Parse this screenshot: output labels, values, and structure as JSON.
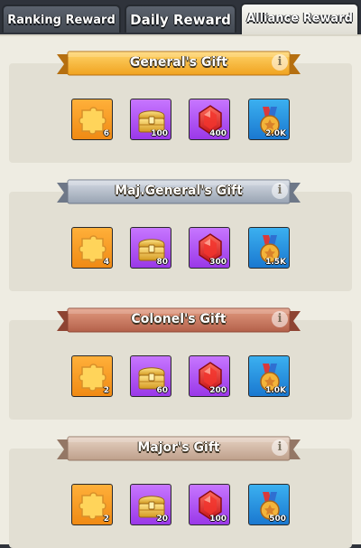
{
  "tabs": [
    {
      "label": "Ranking Reward"
    },
    {
      "label": "Daily Reward"
    },
    {
      "label": "Alliance Reward",
      "active": true
    }
  ],
  "colors": {
    "gold_banner": "#f4b632",
    "silver_banner": "#b3bdc9",
    "copper_banner": "#c87a62",
    "bronze_banner": "#d0b8a7"
  },
  "sections": [
    {
      "title": "General's Gift",
      "banner": "gold",
      "items": [
        {
          "icon": "puzzle-icon",
          "qty": "6"
        },
        {
          "icon": "treasure-chest-icon",
          "qty": "100"
        },
        {
          "icon": "ruby-gem-icon",
          "qty": "400"
        },
        {
          "icon": "medal-icon",
          "qty": "2.0K"
        }
      ]
    },
    {
      "title": "Maj.General's Gift",
      "banner": "silver",
      "items": [
        {
          "icon": "puzzle-icon",
          "qty": "4"
        },
        {
          "icon": "treasure-chest-icon",
          "qty": "80"
        },
        {
          "icon": "ruby-gem-icon",
          "qty": "300"
        },
        {
          "icon": "medal-icon",
          "qty": "1.5K"
        }
      ]
    },
    {
      "title": "Colonel's Gift",
      "banner": "copper",
      "items": [
        {
          "icon": "puzzle-icon",
          "qty": "2"
        },
        {
          "icon": "treasure-chest-icon",
          "qty": "60"
        },
        {
          "icon": "ruby-gem-icon",
          "qty": "200"
        },
        {
          "icon": "medal-icon",
          "qty": "1.0K"
        }
      ]
    },
    {
      "title": "Major's Gift",
      "banner": "bronze",
      "items": [
        {
          "icon": "puzzle-icon",
          "qty": "2"
        },
        {
          "icon": "treasure-chest-icon",
          "qty": "20"
        },
        {
          "icon": "ruby-gem-icon",
          "qty": "100"
        },
        {
          "icon": "medal-icon",
          "qty": "500"
        }
      ]
    }
  ],
  "info_glyph": "i"
}
